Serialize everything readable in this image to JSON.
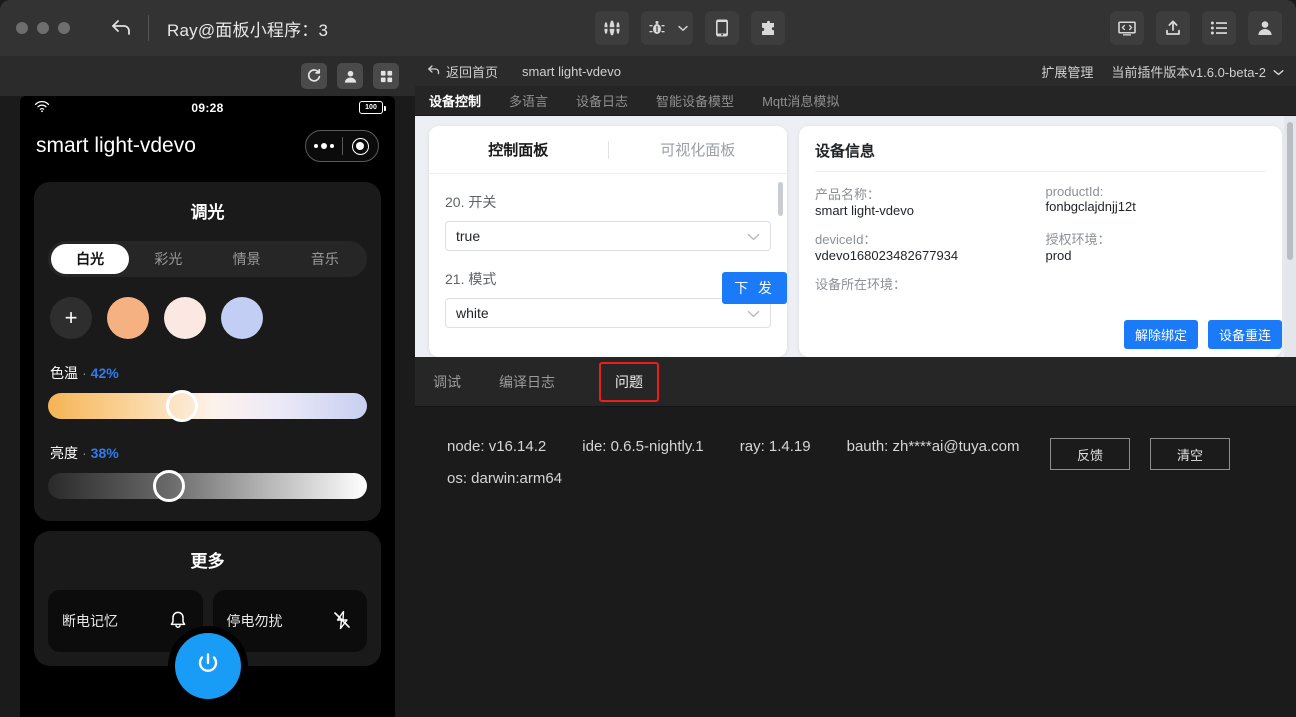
{
  "titlebar": {
    "title": "Ray@面板小程序：3",
    "undo_icon": "undo-icon",
    "center_buttons": [
      {
        "name": "waveform-icon"
      },
      {
        "name": "bug-icon"
      },
      {
        "name": "chevron-down-icon"
      },
      {
        "name": "mobile-icon"
      },
      {
        "name": "puzzle-icon"
      }
    ],
    "right_buttons": [
      {
        "name": "code-preview-icon"
      },
      {
        "name": "upload-icon"
      },
      {
        "name": "list-icon"
      },
      {
        "name": "account-icon"
      }
    ]
  },
  "simulator": {
    "toolbar": [
      {
        "name": "refresh-icon"
      },
      {
        "name": "account-icon"
      },
      {
        "name": "grid-icon"
      }
    ],
    "status": {
      "time": "09:28",
      "battery": "100",
      "wifi_icon": "wifi-icon"
    },
    "device_title": "smart light-vdevo",
    "dimming": {
      "title": "调光",
      "modes": [
        "白光",
        "彩光",
        "情景",
        "音乐"
      ],
      "active_mode": "白光",
      "swatches": [
        "#2e2e2e",
        "#f6b183",
        "#fbe8e2",
        "#c3cef4"
      ],
      "add_label": "+",
      "temperature": {
        "label": "色温",
        "separator": "·",
        "value": "42%",
        "percent": 42
      },
      "brightness": {
        "label": "亮度",
        "separator": "·",
        "value": "38%",
        "percent": 38
      }
    },
    "more": {
      "title": "更多",
      "tiles": [
        {
          "label": "断电记忆",
          "icon": "bell-icon"
        },
        {
          "label": "停电勿扰",
          "icon": "flash-off-icon"
        }
      ]
    },
    "power_button": {
      "icon": "power-icon",
      "color": "#189cf5"
    }
  },
  "breadcrumb": {
    "back_label": "返回首页",
    "back_icon": "back-arrow-icon",
    "device_name": "smart light-vdevo",
    "extension_manage": "扩展管理",
    "plugin_version": "当前插件版本v1.6.0-beta-2",
    "chevron_icon": "chevron-down-icon"
  },
  "nav_tabs": {
    "items": [
      "设备控制",
      "多语言",
      "设备日志",
      "智能设备模型",
      "Mqtt消息模拟"
    ],
    "active": "设备控制"
  },
  "control_panel": {
    "tabs": [
      "控制面板",
      "可视化面板"
    ],
    "active_tab": "控制面板",
    "fields": [
      {
        "label": "20. 开关",
        "value": "true",
        "chevron": "chevron-down-icon"
      },
      {
        "label": "21. 模式",
        "value": "white",
        "chevron": "chevron-down-icon"
      }
    ],
    "send_button": "下 发"
  },
  "device_info": {
    "title": "设备信息",
    "rows": [
      {
        "key": "产品名称：",
        "value": "smart light-vdevo"
      },
      {
        "key": "productId:",
        "value": "fonbgclajdnjj12t"
      },
      {
        "key": "deviceId：",
        "value": "vdevo168023482677934"
      },
      {
        "key": "授权环境：",
        "value": "prod"
      },
      {
        "key": "设备所在环境：",
        "value": ""
      }
    ],
    "actions": [
      "解除绑定",
      "设备重连"
    ]
  },
  "console": {
    "tabs": [
      "调试",
      "编译日志",
      "问题"
    ],
    "active_tab": "问题",
    "highlight_color": "#e8201a",
    "log_line1": [
      "node: v16.14.2",
      "ide: 0.6.5-nightly.1",
      "ray: 1.4.19",
      "bauth: zh****ai@tuya.com"
    ],
    "log_line2": "os: darwin:arm64",
    "buttons": [
      "反馈",
      "清空"
    ]
  }
}
